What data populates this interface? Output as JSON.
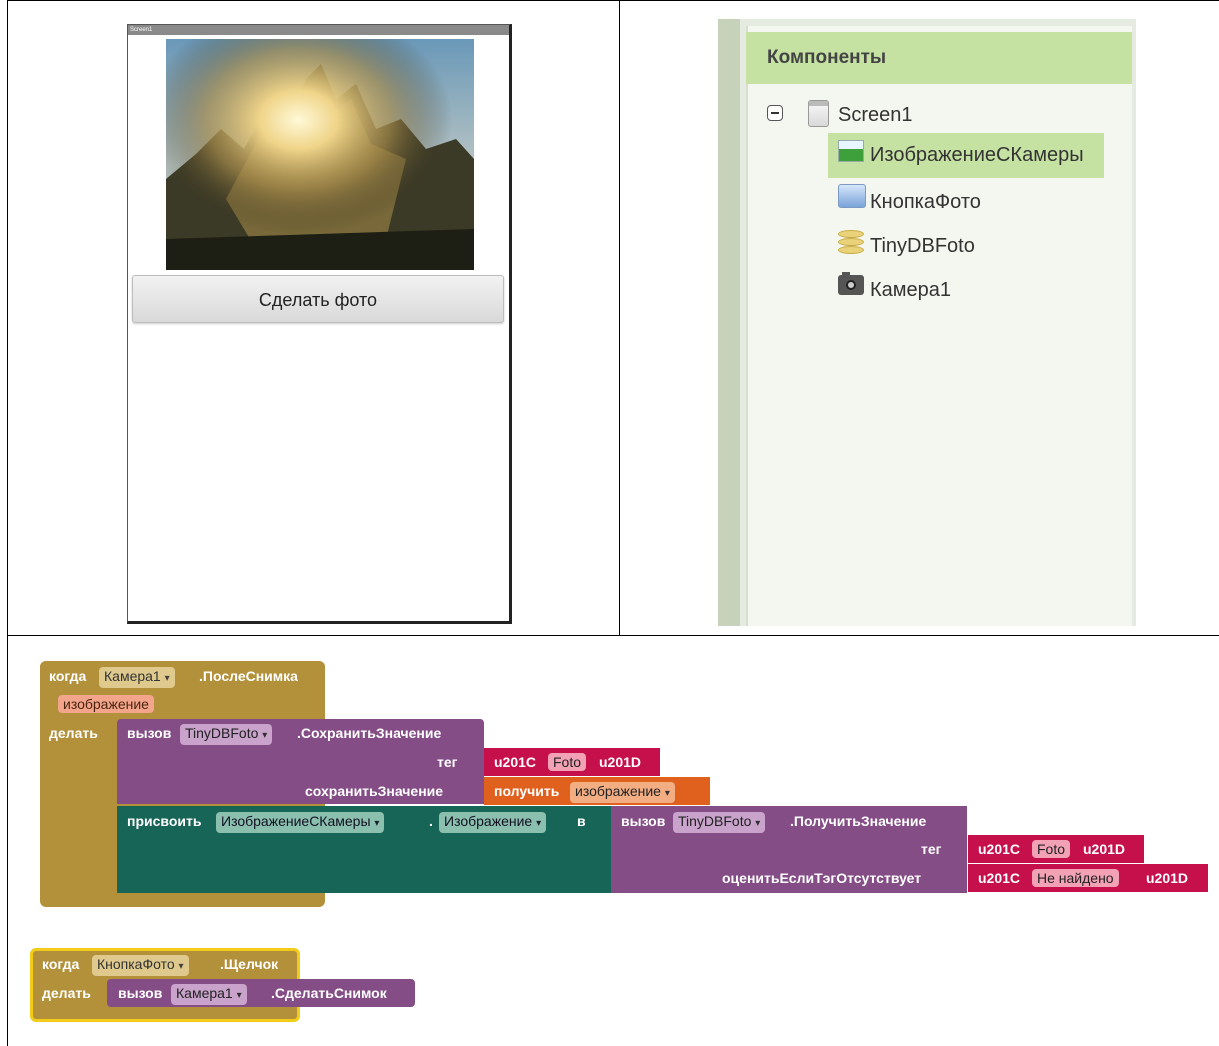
{
  "phone": {
    "screen_title": "Screen1",
    "button_label": "Сделать фото"
  },
  "components": {
    "header": "Компоненты",
    "tree": [
      {
        "label": "Screen1",
        "icon": "screen-icon"
      },
      {
        "label": "ИзображениеСКамеры",
        "icon": "image-icon",
        "selected": true
      },
      {
        "label": "КнопкаФото",
        "icon": "button-icon"
      },
      {
        "label": "TinyDBFoto",
        "icon": "database-icon"
      },
      {
        "label": "Камера1",
        "icon": "camera-icon"
      }
    ],
    "selected_color": "#c5e2a3"
  },
  "blocks": {
    "after_picture": {
      "when": "когда",
      "component": "Камера1",
      "event": ".ПослеСнимка",
      "param": "изображение",
      "do": "делать",
      "store_call": "вызов",
      "store_component": "TinyDBFoto",
      "store_method": ".СохранитьЗначение",
      "tag_label": "тег",
      "tag_open": "u201C",
      "tag_value": "Foto",
      "tag_close": "u201D",
      "value_label": "сохранитьЗначение",
      "get_label": "получить",
      "get_var": "изображение",
      "set_label": "присвоить",
      "set_component": "ИзображениеСКамеры",
      "set_dot": ".",
      "set_property": "Изображение",
      "set_to": "в",
      "get_call": "вызов",
      "get_component": "TinyDBFoto",
      "get_method": ".ПолучитьЗначение",
      "get_tag_label": "тег",
      "get_tag_open": "u201C",
      "get_tag_value": "Foto",
      "get_tag_close": "u201D",
      "absent_label": "оценитьЕслиТэгОтсутствует",
      "absent_open": "u201C",
      "absent_value": "Не найдено",
      "absent_close": "u201D"
    },
    "click": {
      "when": "когда",
      "component": "КнопкаФото",
      "event": ".Щелчок",
      "do": "делать",
      "call": "вызов",
      "call_component": "Камера1",
      "call_method": ".СделатьСнимок"
    }
  },
  "colors": {
    "event_block": "#b3913a",
    "procedure_block": "#844d86",
    "setter_block": "#176556",
    "text_block": "#c6104b",
    "variable_block": "#e0601e",
    "selected_outline": "#f2cc18"
  }
}
